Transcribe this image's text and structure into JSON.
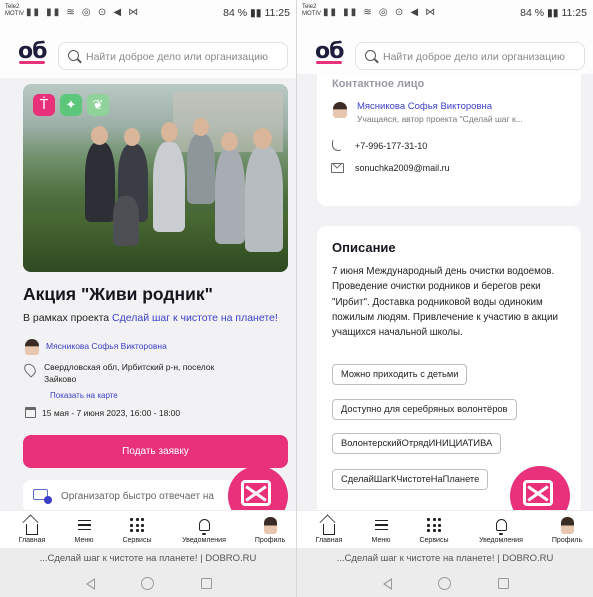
{
  "status": {
    "carrier": "Tele2 MOTIV",
    "icons": "▮▮ ▮▮ ≋ ◎ ⊙ ◀ ⋈",
    "battery": "84 % ▮▮ 11:25"
  },
  "header": {
    "logo": "об",
    "search_placeholder": "Найти доброе дело или организацию"
  },
  "event": {
    "badges": [
      "Ṫ",
      "✦",
      "❦"
    ],
    "title": "Акция \"Живи родник\"",
    "project_prefix": "В рамках проекта",
    "project_link": "Сделай шаг к чистоте на планете!",
    "organizer": "Мясникова Софья Викторовна",
    "address": "Свердловская обл, Ирбитский р-н, поселок Зайково",
    "map_link": "Показать на карте",
    "dates": "15 мая - 7 июня 2023, 16:00 - 18:00",
    "apply_button": "Подать заявку",
    "notice": "Организатор быстро отвечает на"
  },
  "contact": {
    "heading": "Контактное лицо",
    "name": "Мясникова Софья Викторовна",
    "role": "Учащаяся, автор проекта \"Сделай шаг к...",
    "phone": "+7-996-177-31-10",
    "email": "sonuchka2009@mail.ru"
  },
  "description": {
    "heading": "Описание",
    "text": "7 июня Международный день очистки водоемов. Проведение очистки родников и берегов реки \"Ирбит\". Доставка родниковой воды одиноким пожилым людям. Привлечение к участию в акции учащихся начальной школы.",
    "tags": [
      "Можно приходить с детьми",
      "Доступно для серебряных волонтёров",
      "ВолонтерскийОтрядИНИЦИАТИВА",
      "СделайШагКЧистотеНаПланете"
    ]
  },
  "nav": {
    "home": "Главная",
    "menu": "Меню",
    "services": "Сервисы",
    "notifications": "Уведомления",
    "profile": "Профиль"
  },
  "browser": {
    "page_title": "...Сделай шаг к чистоте на планете! | DOBRO.RU"
  },
  "colors": {
    "accent": "#e8317a",
    "link": "#3b3fc8",
    "badge_pink": "#e8317a",
    "badge_green": "#5cc77a",
    "badge_lightgreen": "#8fd39a"
  }
}
